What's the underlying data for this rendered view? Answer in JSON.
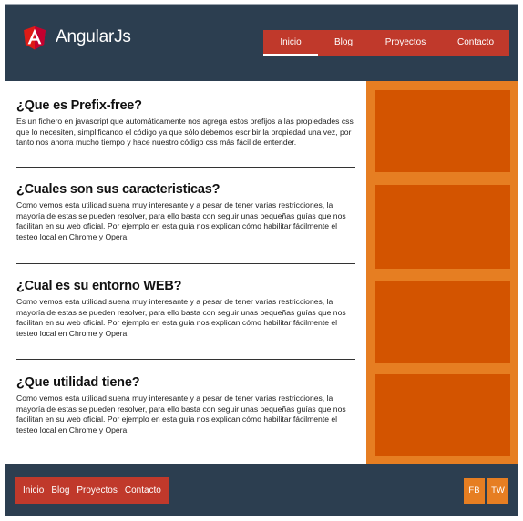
{
  "brand": {
    "name": "AngularJs",
    "logo_icon": "angular-shield-logo",
    "colors": {
      "shield_left": "#dd1b16",
      "shield_right": "#c3002f"
    }
  },
  "nav": {
    "items": [
      {
        "label": "Inicio",
        "active": true
      },
      {
        "label": "Blog"
      },
      {
        "label": "Proyectos"
      },
      {
        "label": "Contacto"
      }
    ]
  },
  "sections": [
    {
      "title": "¿Que es Prefix-free?",
      "body": "Es un fichero en javascript que automáticamente nos agrega estos prefijos a las propiedades css que lo necesiten, simplificando el código ya que sólo debemos escribir la propiedad una vez, por tanto nos ahorra mucho tiempo y hace nuestro código css más fácil de entender."
    },
    {
      "title": "¿Cuales son sus caracteristicas?",
      "body": "Como vemos esta utilidad suena muy interesante y a pesar de tener varias restricciones, la mayoría de estas se pueden resolver, para ello basta con seguir unas pequeñas guías que nos facilitan en su web oficial. Por ejemplo en esta guía nos explican cómo habilitar fácilmente el testeo local en Chrome y Opera."
    },
    {
      "title": "¿Cual es su entorno WEB?",
      "body": "Como vemos esta utilidad suena muy interesante y a pesar de tener varias restricciones, la mayoría de estas se pueden resolver, para ello basta con seguir unas pequeñas guías que nos facilitan en su web oficial. Por ejemplo en esta guía nos explican cómo habilitar fácilmente el testeo local en Chrome y Opera."
    },
    {
      "title": "¿Que utilidad tiene?",
      "body": "Como vemos esta utilidad suena muy interesante y a pesar de tener varias restricciones, la mayoría de estas se pueden resolver, para ello basta con seguir unas pequeñas guías que nos facilitan en su web oficial. Por ejemplo en esta guía nos explican cómo habilitar fácilmente el testeo local en Chrome y Opera."
    }
  ],
  "footer": {
    "nav": [
      "Inicio",
      "Blog",
      "Proyectos",
      "Contacto"
    ],
    "social": {
      "fb": "FB",
      "tw": "TW"
    }
  },
  "colors": {
    "header_bg": "#2c3e50",
    "nav_bg": "#c0392b",
    "sidebar_bg": "#e67e22",
    "sidebar_box": "#d35400"
  }
}
